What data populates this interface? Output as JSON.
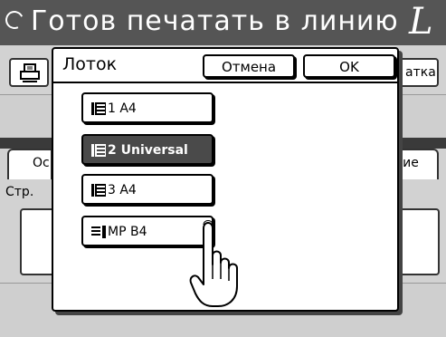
{
  "header": {
    "title": "Готов печатать в линию",
    "badge": "L"
  },
  "background": {
    "right_button_label": "атка",
    "tab_left_label": "Ос",
    "tab_right_label": "ние",
    "page_label": "Стр."
  },
  "dialog": {
    "title": "Лоток",
    "cancel_label": "Отмена",
    "ok_label": "OK",
    "trays": [
      {
        "label": "1  A4",
        "selected": false
      },
      {
        "label": "2  Universal",
        "selected": true
      },
      {
        "label": "3  A4",
        "selected": false
      },
      {
        "label": "MP  B4",
        "selected": false
      }
    ]
  },
  "colors": {
    "header_bg": "#555555",
    "selected_bg": "#4a4a4a",
    "panel_bg": "#d2d2d2"
  }
}
